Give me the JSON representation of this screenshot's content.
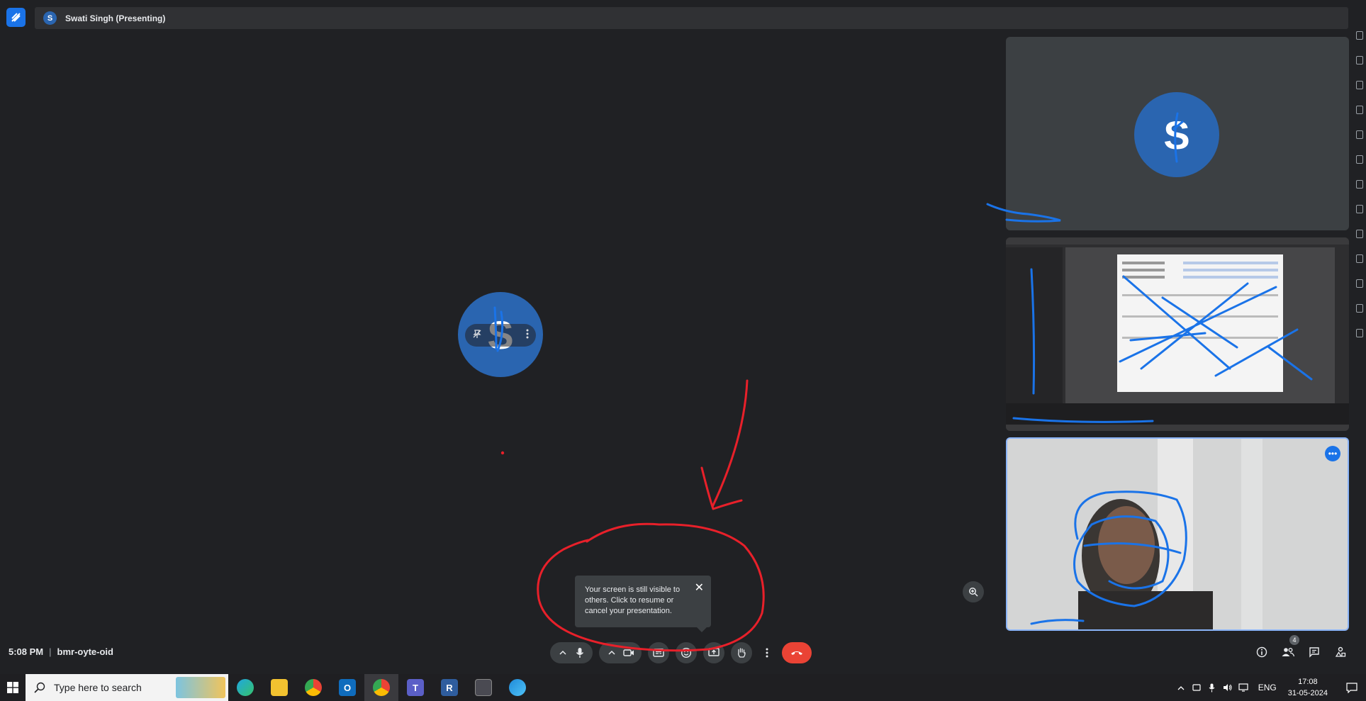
{
  "header": {
    "presenter_initial": "S",
    "presenter_label": "Swati Singh (Presenting)"
  },
  "stage": {
    "avatar_initial": "S"
  },
  "tiles": {
    "tile1_initial": "S",
    "tile3_more": "•••"
  },
  "tooltip": {
    "text": "Your screen is still visible to others. Click to resume or cancel your presentation.",
    "close": "✕"
  },
  "meeting": {
    "time": "5:08 PM",
    "separator": "|",
    "code": "bmr-oyte-oid"
  },
  "right_controls": {
    "participants_count": "4"
  },
  "taskbar": {
    "search_placeholder": "Type here to search",
    "apps": [
      "edge",
      "file-explorer",
      "chrome",
      "outlook",
      "chrome",
      "teams",
      "r-app",
      "calculator",
      "edge-beta"
    ],
    "tray_lang": "ENG",
    "time": "17:08",
    "date": "31-05-2024"
  },
  "colors": {
    "background": "#202124",
    "accent_blue": "#1a73e8",
    "avatar_blue": "#2a65b0",
    "end_call_red": "#ea4335",
    "ink_blue": "#1a73e8",
    "ink_red": "#e8202a"
  }
}
